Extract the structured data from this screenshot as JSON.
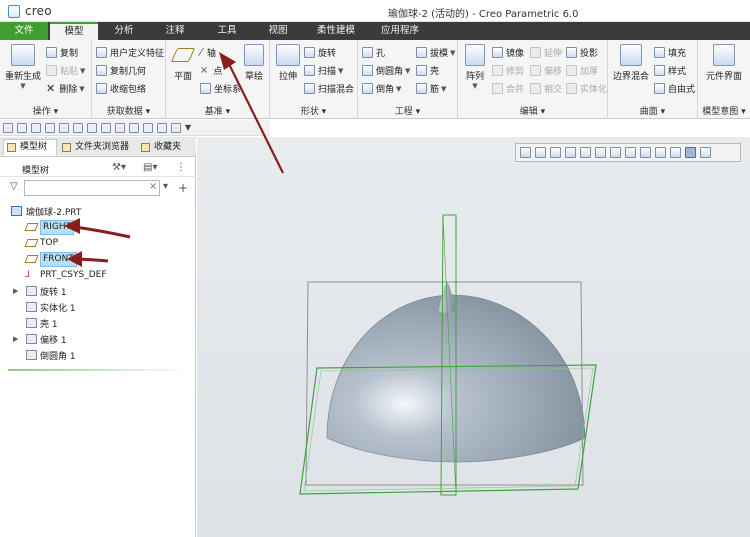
{
  "app": {
    "logo_text": "creo",
    "window_title": "瑜伽球-2 (活动的) - Creo Parametric 6.0"
  },
  "tabs": [
    "文件",
    "模型",
    "分析",
    "注释",
    "工具",
    "视图",
    "柔性建模",
    "应用程序"
  ],
  "ribbon": {
    "operations": {
      "label": "操作",
      "regenerate": "重新生成",
      "copy": "复制",
      "paste": "粘贴",
      "delete": "删除"
    },
    "get_data": {
      "label": "获取数据",
      "udf": "用户定义特征",
      "copy_geom": "复制几何",
      "shrinkwrap": "收缩包络"
    },
    "datum": {
      "label": "基准",
      "plane": "平面",
      "axis": "轴",
      "point": "点",
      "csys": "坐标系",
      "sketch": "草绘"
    },
    "shapes": {
      "label": "形状",
      "extrude": "拉伸",
      "revolve": "旋转",
      "sweep": "扫描",
      "swept_blend": "扫描混合"
    },
    "engineering": {
      "label": "工程",
      "hole": "孔",
      "round": "倒圆角",
      "chamfer": "倒角",
      "draft": "拔模",
      "shell": "壳",
      "rib": "筋"
    },
    "editing": {
      "label": "编辑",
      "pattern": "阵列",
      "mirror": "镜像",
      "extend": "延伸",
      "project": "投影",
      "trim": "修剪",
      "offset": "偏移",
      "thicken": "加厚",
      "merge": "合并",
      "intersect": "相交",
      "solidify": "实体化"
    },
    "surfaces": {
      "label": "曲面",
      "boundary_blend": "边界混合",
      "fill": "填充",
      "style": "样式",
      "freestyle": "自由式"
    },
    "model_intent": {
      "label": "模型意图",
      "component_interface": "元件界面"
    }
  },
  "panel": {
    "tabs": [
      "模型树",
      "文件夹浏览器",
      "收藏夹"
    ],
    "tree_header": "模型树",
    "search_placeholder": "",
    "items": [
      {
        "label": "瑜伽球-2.PRT",
        "icon": "part-icon"
      },
      {
        "label": "RIGHT",
        "icon": "datum-plane-icon",
        "selected": true
      },
      {
        "label": "TOP",
        "icon": "datum-plane-icon"
      },
      {
        "label": "FRONT",
        "icon": "datum-plane-icon",
        "selected": true
      },
      {
        "label": "PRT_CSYS_DEF",
        "icon": "csys-icon"
      },
      {
        "label": "旋转 1",
        "icon": "revolve-icon",
        "expandable": true
      },
      {
        "label": "实体化 1",
        "icon": "solidify-icon"
      },
      {
        "label": "壳 1",
        "icon": "shell-icon"
      },
      {
        "label": "偏移 1",
        "icon": "offset-icon",
        "expandable": true
      },
      {
        "label": "倒圆角 1",
        "icon": "round-icon"
      }
    ]
  },
  "colors": {
    "accent_green": "#3f9e2f",
    "tab_bar": "#3b3b3b",
    "annotation_arrow": "#8a1e1e",
    "model_fill": "#a9b5c2",
    "datum_plane": "#3fa33f"
  }
}
